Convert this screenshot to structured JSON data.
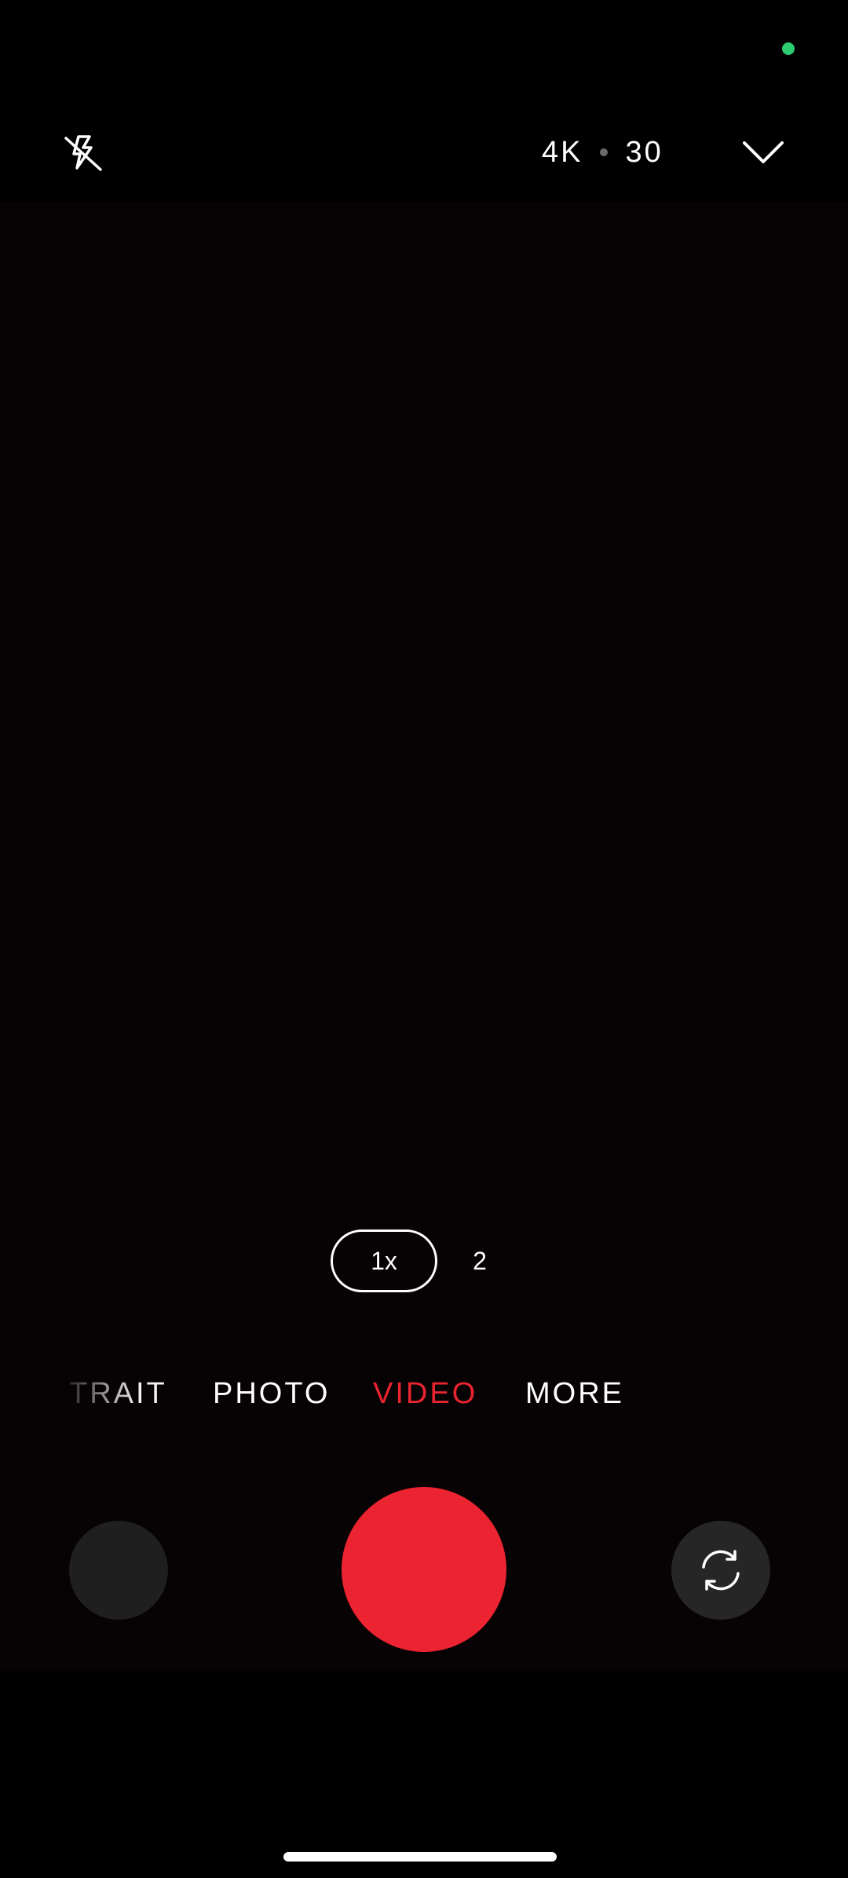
{
  "top_bar": {
    "flash_icon": "flash-off-icon",
    "resolution": "4K",
    "fps": "30",
    "chevron_icon": "chevron-down-icon"
  },
  "status": {
    "indicator_color": "#2ecc71"
  },
  "zoom": {
    "options": [
      "1x",
      "2"
    ],
    "selected": "1x"
  },
  "modes": {
    "portrait_partial": "TRAIT",
    "photo": "PHOTO",
    "video": "VIDEO",
    "more": "MORE",
    "active": "VIDEO",
    "active_color": "#e8242f"
  },
  "controls": {
    "record_color": "#ec2330",
    "switch_icon": "switch-camera-icon",
    "gallery_icon": "gallery-thumbnail"
  }
}
